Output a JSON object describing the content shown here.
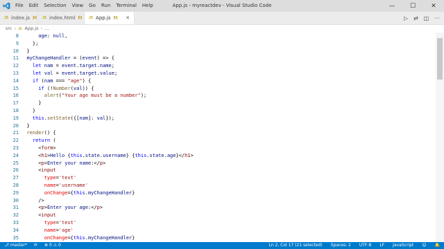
{
  "titlebar": {
    "title": "App.js - myreactdev - Visual Studio Code",
    "menu": [
      "File",
      "Edit",
      "Selection",
      "View",
      "Go",
      "Run",
      "Terminal",
      "Help"
    ],
    "controls": {
      "minimize": "—",
      "maximize": "☐",
      "close": "✕"
    }
  },
  "tabs": [
    {
      "badge": "JS",
      "label": "index.js",
      "modified": "M",
      "active": false
    },
    {
      "badge": "JS",
      "label": "index.html",
      "modified": "M",
      "active": false
    },
    {
      "badge": "JS",
      "label": "App.js",
      "modified": "M",
      "active": true
    }
  ],
  "breadcrumb": {
    "folder": "src",
    "file": "App.js",
    "more": "..."
  },
  "editor": {
    "lines": [
      {
        "n": "8",
        "code": "      age: null,"
      },
      {
        "n": "9",
        "code": "    };"
      },
      {
        "n": "10",
        "code": "  }"
      },
      {
        "n": "11",
        "code": "  myChangeHandler = (event) => {"
      },
      {
        "n": "12",
        "code": "    let nam = event.target.name;"
      },
      {
        "n": "13",
        "code": "    let val = event.target.value;"
      },
      {
        "n": "14",
        "code": "    if (nam === \"age\") {"
      },
      {
        "n": "15",
        "code": "      if (!Number(val)) {"
      },
      {
        "n": "16",
        "code": "        alert(\"Your age must be a number\");"
      },
      {
        "n": "17",
        "code": "      }"
      },
      {
        "n": "18",
        "code": "    }"
      },
      {
        "n": "19",
        "code": "    this.setState({[nam]: val});"
      },
      {
        "n": "20",
        "code": "  }"
      },
      {
        "n": "21",
        "code": "  render() {"
      },
      {
        "n": "22",
        "code": "    return ("
      },
      {
        "n": "23",
        "code": "      <form>"
      },
      {
        "n": "24",
        "code": "      <h1>Hello {this.state.username} {this.state.age}</h1>"
      },
      {
        "n": "25",
        "code": "      <p>Enter your name:</p>"
      },
      {
        "n": "26",
        "code": "      <input"
      },
      {
        "n": "27",
        "code": "        type='text'"
      },
      {
        "n": "28",
        "code": "        name='username'"
      },
      {
        "n": "29",
        "code": "        onChange={this.myChangeHandler}"
      },
      {
        "n": "30",
        "code": "      />"
      },
      {
        "n": "31",
        "code": "      <p>Enter your age:</p>"
      },
      {
        "n": "32",
        "code": "      <input"
      },
      {
        "n": "33",
        "code": "        type='text'"
      },
      {
        "n": "34",
        "code": "        name='age'"
      },
      {
        "n": "35",
        "code": "        onChange={this.myChangeHandler}"
      }
    ]
  },
  "statusbar": {
    "branch": "master*",
    "sync": "⟳",
    "errors": "⊗ 0 ⚠ 0",
    "position": "Ln 2, Col 17 (21 selected)",
    "spaces": "Spaces: 2",
    "encoding": "UTF-8",
    "eol": "LF",
    "language": "JavaScript"
  },
  "colors": {
    "statusbar": "#007acc",
    "keyword": "#0000ff",
    "string": "#a31515",
    "tag": "#800000",
    "attr": "#e50000",
    "linenumber": "#237893"
  }
}
